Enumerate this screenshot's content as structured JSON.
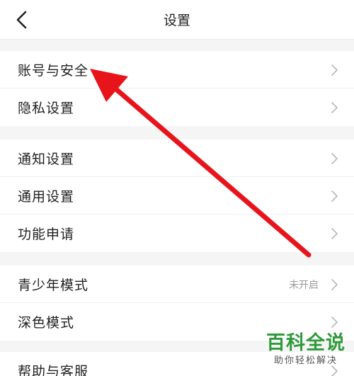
{
  "header": {
    "title": "设置",
    "back_icon": "chevron-left-icon"
  },
  "groups": [
    {
      "items": [
        {
          "label": "账号与安全"
        },
        {
          "label": "隐私设置"
        }
      ]
    },
    {
      "items": [
        {
          "label": "通知设置"
        },
        {
          "label": "通用设置"
        },
        {
          "label": "功能申请"
        }
      ]
    },
    {
      "items": [
        {
          "label": "青少年模式",
          "value": "未开启"
        },
        {
          "label": "深色模式"
        }
      ]
    },
    {
      "items": [
        {
          "label": "帮助与客服"
        }
      ]
    }
  ],
  "annotation": {
    "arrow_color": "#e8141c",
    "points_to": "账号与安全"
  },
  "watermark": {
    "main": "百科全说",
    "sub": "助你轻松解决",
    "color": "#2e9b3a"
  }
}
